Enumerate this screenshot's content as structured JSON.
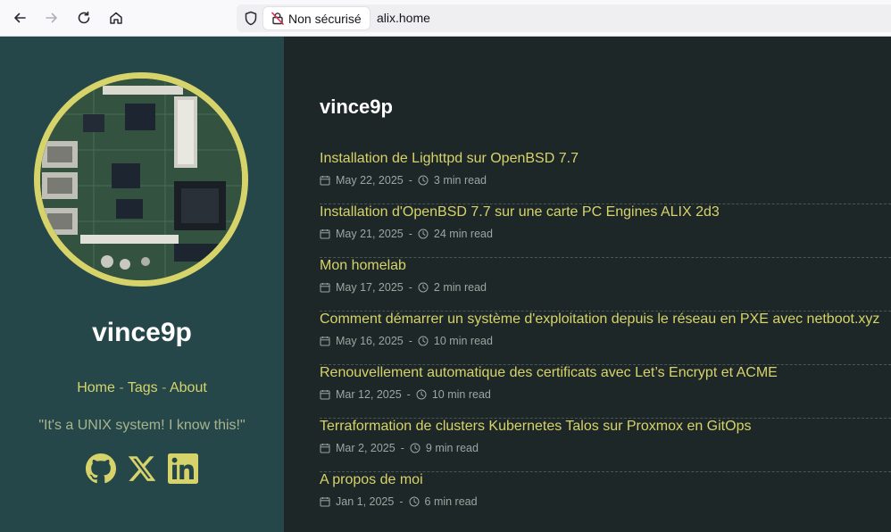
{
  "browser": {
    "security_label": "Non sécurisé",
    "url": "alix.home"
  },
  "sidebar": {
    "title": "vince9p",
    "nav": [
      {
        "label": "Home"
      },
      {
        "label": "Tags"
      },
      {
        "label": "About"
      }
    ],
    "nav_separator": " - ",
    "tagline": "\"It's a UNIX system! I know this!\"",
    "socials": [
      "github-icon",
      "x-icon",
      "linkedin-icon"
    ]
  },
  "main": {
    "title": "vince9p",
    "posts": [
      {
        "title": "Installation de Lighttpd sur OpenBSD 7.7",
        "date": "May 22, 2025",
        "read": "3 min read"
      },
      {
        "title": "Installation d'OpenBSD 7.7 sur une carte PC Engines ALIX 2d3",
        "date": "May 21, 2025",
        "read": "24 min read"
      },
      {
        "title": "Mon homelab",
        "date": "May 17, 2025",
        "read": "2 min read"
      },
      {
        "title": "Comment démarrer un système d'exploitation depuis le réseau en PXE avec netboot.xyz",
        "date": "May 16, 2025",
        "read": "10 min read"
      },
      {
        "title": "Renouvellement automatique des certificats avec Let’s Encrypt et ACME",
        "date": "Mar 12, 2025",
        "read": "10 min read"
      },
      {
        "title": "Terraformation de clusters Kubernetes Talos sur Proxmox en GitOps",
        "date": "Mar 2, 2025",
        "read": "9 min read"
      },
      {
        "title": "A propos de moi",
        "date": "Jan 1, 2025",
        "read": "6 min read"
      }
    ],
    "meta_separator": "-"
  },
  "colors": {
    "accent": "#d6d36a",
    "sidebar_bg": "#25474a",
    "main_bg": "#1e2728"
  }
}
